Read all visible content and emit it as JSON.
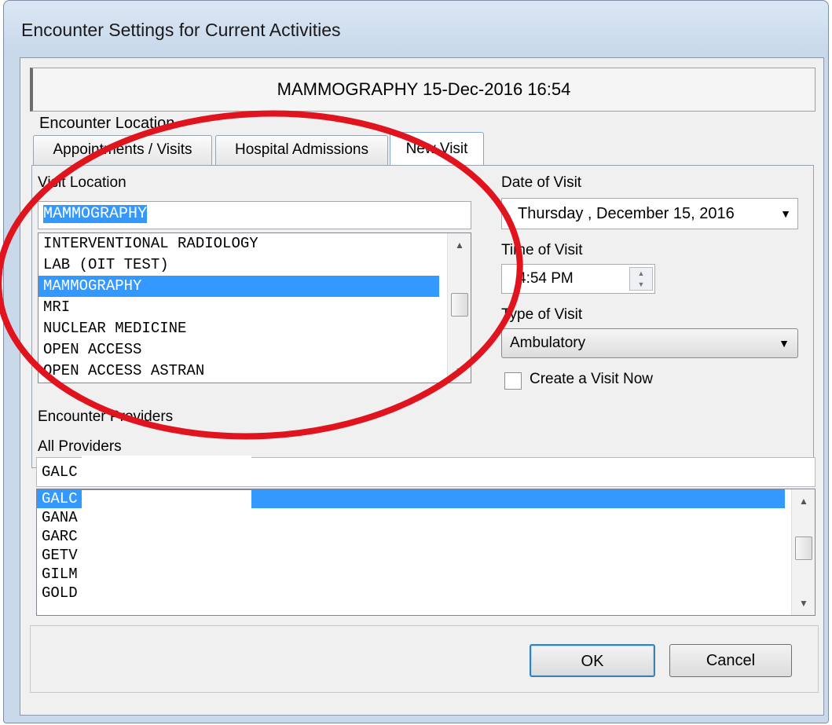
{
  "window": {
    "title": "Encounter Settings for Current Activities"
  },
  "activity": {
    "header": "MAMMOGRAPHY  15-Dec-2016 16:54"
  },
  "encounter_location": {
    "group_label": "Encounter Location",
    "tabs": [
      {
        "label": "Appointments / Visits"
      },
      {
        "label": "Hospital Admissions"
      },
      {
        "label": "New Visit"
      }
    ],
    "active_tab": "New Visit",
    "visit_location": {
      "label": "Visit Location",
      "value": "MAMMOGRAPHY",
      "items": [
        "INTERVENTIONAL RADIOLOGY",
        "LAB (OIT TEST)",
        "MAMMOGRAPHY",
        "MRI",
        "NUCLEAR MEDICINE",
        "OPEN ACCESS",
        "OPEN ACCESS ASTRAN"
      ],
      "selected": "MAMMOGRAPHY"
    },
    "date_of_visit": {
      "label": "Date of Visit",
      "value": "Thursday  , December 15, 2016"
    },
    "time_of_visit": {
      "label": "Time of Visit",
      "value": "4:54 PM"
    },
    "type_of_visit": {
      "label": "Type of Visit",
      "value": "Ambulatory"
    },
    "create_visit_now": {
      "label": "Create a Visit Now",
      "checked": false
    }
  },
  "encounter_providers": {
    "group_label": "Encounter Providers",
    "all_providers_label": "All Providers",
    "input_value": "GALC",
    "items": [
      "GALC",
      "GANA",
      "GARC",
      "GETV",
      "GILM",
      "GOLD"
    ],
    "selected": "GALC"
  },
  "buttons": {
    "ok": "OK",
    "cancel": "Cancel"
  },
  "colors": {
    "selection": "#3399ff",
    "annotation": "#e0141e",
    "titlebar": "#c9d9ea"
  }
}
